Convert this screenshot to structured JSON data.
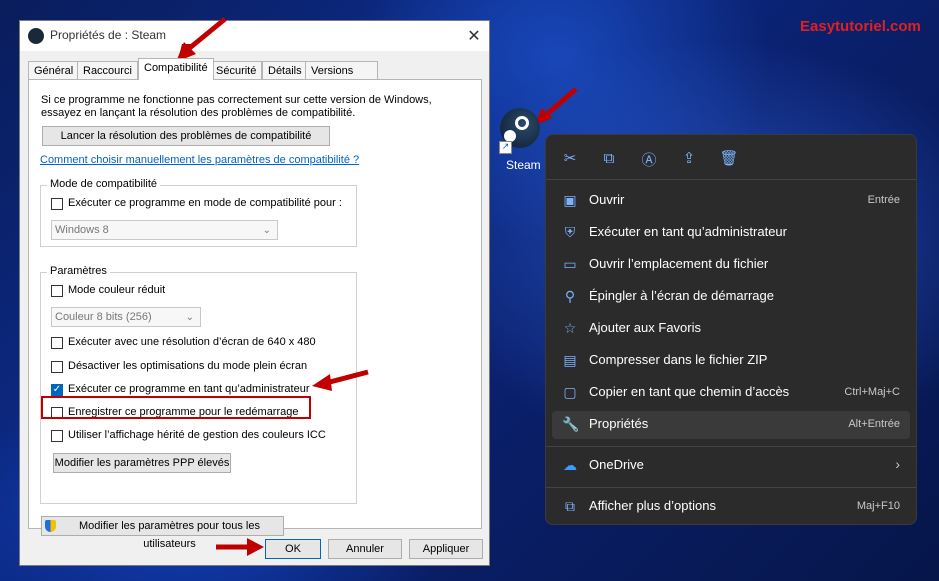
{
  "watermark": "Easytutoriel.com",
  "dialog": {
    "title": "Propriétés de : Steam",
    "close_glyph": "✕",
    "tabs": [
      "Général",
      "Raccourci",
      "Compatibilité",
      "Sécurité",
      "Détails",
      "Versions précédentes"
    ],
    "intro_line1": "Si ce programme ne fonctionne pas correctement sur cette version de Windows,",
    "intro_line2": "essayez en lançant la résolution des problèmes de compatibilité.",
    "troubleshoot_button": "Lancer la résolution des problèmes de compatibilité",
    "manual_link": "Comment choisir manuellement les paramètres de compatibilité ?",
    "compat_group": {
      "label": "Mode de compatibilité",
      "checkbox": "Exécuter ce programme en mode de compatibilité pour :",
      "select_value": "Windows 8"
    },
    "settings_group": {
      "label": "Paramètres",
      "reduced_color": "Mode couleur réduit",
      "color_select": "Couleur 8 bits (256)",
      "res_640": "Exécuter avec une résolution d’écran de 640 x 480",
      "disable_fullscreen": "Désactiver les optimisations du mode plein écran",
      "run_admin": "Exécuter ce programme en tant qu’administrateur",
      "register_restart": "Enregistrer ce programme pour le redémarrage",
      "icc": "Utiliser l’affichage hérité de gestion des couleurs ICC",
      "dpi_button": "Modifier les paramètres PPP élevés"
    },
    "all_users_button": "Modifier les paramètres pour tous les utilisateurs",
    "ok": "OK",
    "cancel": "Annuler",
    "apply": "Appliquer"
  },
  "desktop": {
    "steam_label": "Steam"
  },
  "context_menu": {
    "toolbar": [
      "cut-icon",
      "copy-icon",
      "rename-icon",
      "share-icon",
      "delete-icon"
    ],
    "items": [
      {
        "label": "Ouvrir",
        "shortcut": "Entrée"
      },
      {
        "label": "Exécuter en tant qu’administrateur",
        "shortcut": ""
      },
      {
        "label": "Ouvrir l’emplacement du fichier",
        "shortcut": ""
      },
      {
        "label": "Épingler à l’écran de démarrage",
        "shortcut": ""
      },
      {
        "label": "Ajouter aux Favoris",
        "shortcut": ""
      },
      {
        "label": "Compresser dans le fichier ZIP",
        "shortcut": ""
      },
      {
        "label": "Copier en tant que chemin d’accès",
        "shortcut": "Ctrl+Maj+C"
      },
      {
        "label": "Propriétés",
        "shortcut": "Alt+Entrée"
      },
      {
        "label": "OneDrive",
        "shortcut": "›"
      },
      {
        "label": "Afficher plus d’options",
        "shortcut": "Maj+F10"
      }
    ]
  },
  "colors": {
    "accent": "#0067c0",
    "highlight_red": "#c00000",
    "menu_bg": "#2b2b2b"
  }
}
